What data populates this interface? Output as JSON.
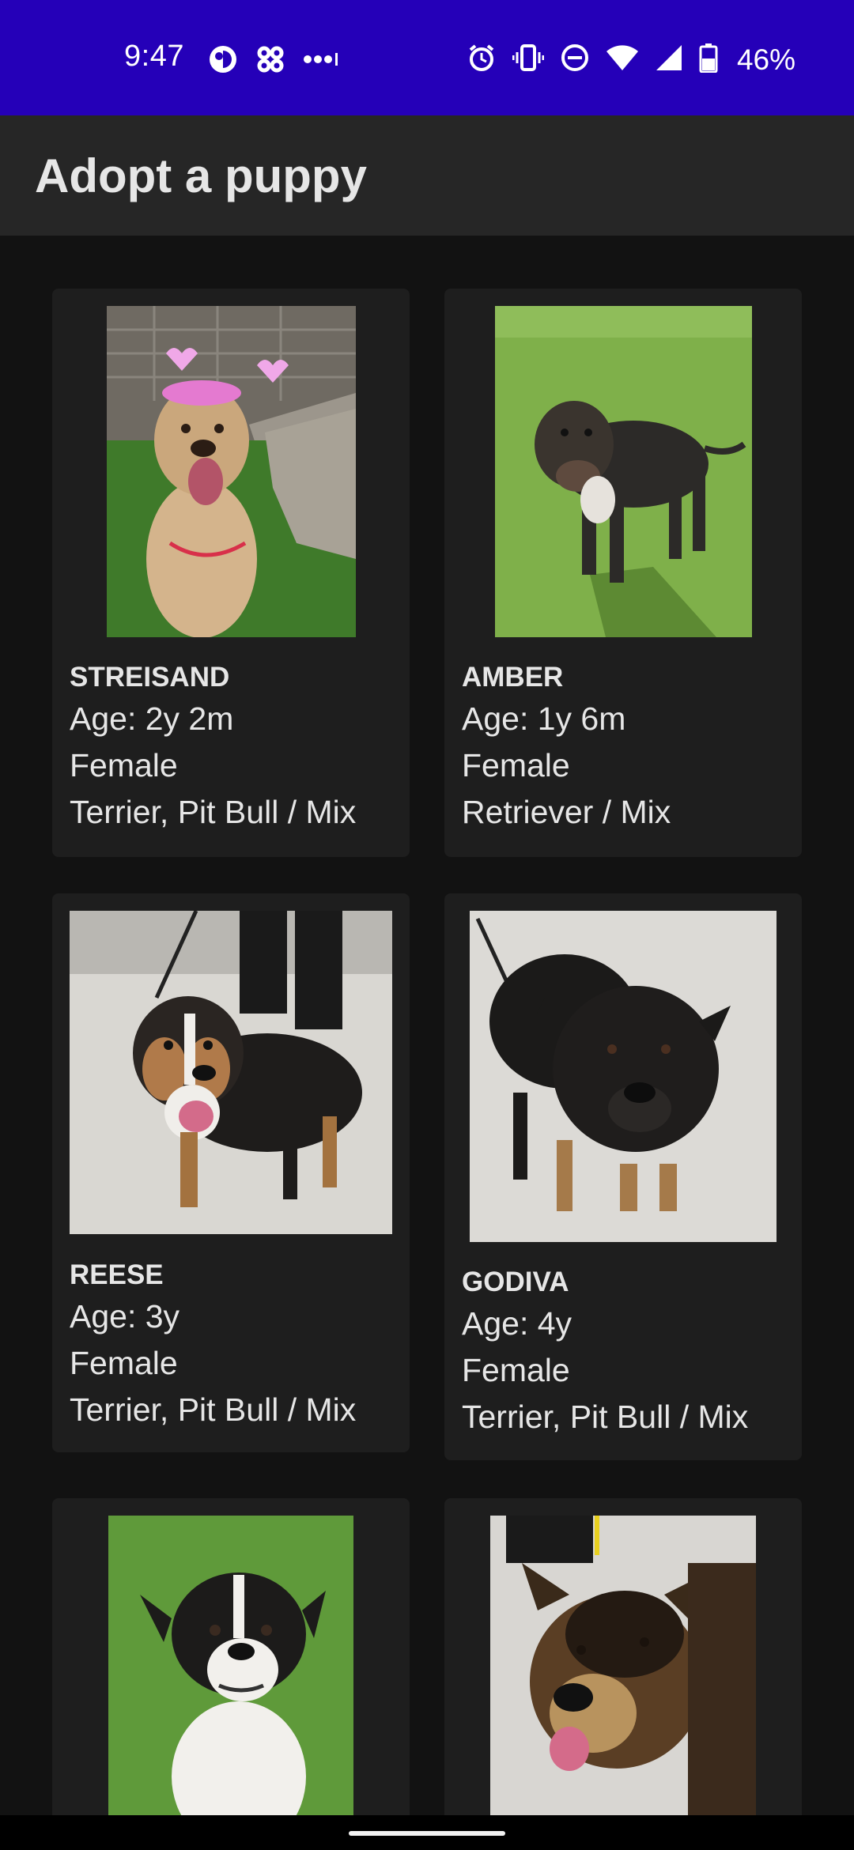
{
  "status": {
    "time": "9:47",
    "battery": "46%",
    "icons_left": [
      "app-icon",
      "grid-icon",
      "more-dots-icon"
    ],
    "icons_right": [
      "alarm-icon",
      "vibrate-icon",
      "dnd-icon",
      "wifi-icon",
      "signal-icon",
      "battery-icon"
    ]
  },
  "app": {
    "title": "Adopt a puppy"
  },
  "puppies": [
    {
      "name": "STREISAND",
      "age": "Age: 2y 2m",
      "sex": "Female",
      "breed": "Terrier, Pit Bull / Mix"
    },
    {
      "name": "AMBER",
      "age": "Age: 1y 6m",
      "sex": "Female",
      "breed": "Retriever / Mix"
    },
    {
      "name": "REESE",
      "age": "Age: 3y",
      "sex": "Female",
      "breed": "Terrier, Pit Bull / Mix"
    },
    {
      "name": "GODIVA",
      "age": "Age: 4y",
      "sex": "Female",
      "breed": "Terrier, Pit Bull / Mix"
    },
    {
      "name": "",
      "age": "",
      "sex": "",
      "breed": ""
    },
    {
      "name": "",
      "age": "",
      "sex": "",
      "breed": ""
    }
  ],
  "colors": {
    "status_bar": "#2500b8",
    "app_bar": "#262626",
    "background": "#121212",
    "card": "#1e1e1e",
    "text": "#e6e6e6"
  }
}
